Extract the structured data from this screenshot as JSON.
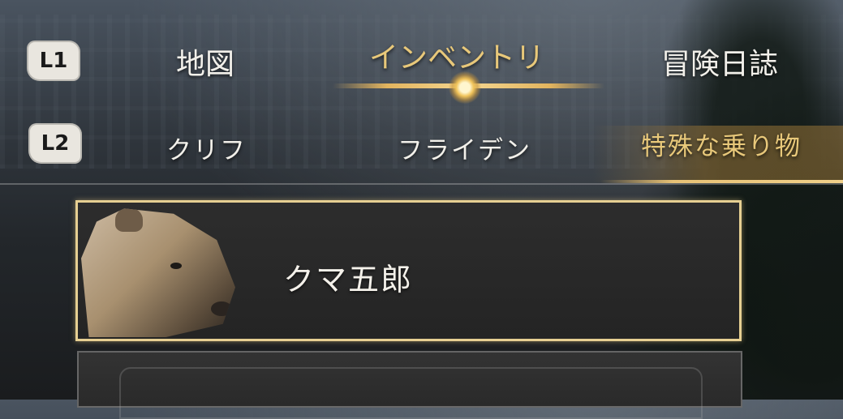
{
  "header": {
    "top_tabs": {
      "button_hint": "L1",
      "items": [
        {
          "label": "地図",
          "active": false
        },
        {
          "label": "インベントリ",
          "active": true
        },
        {
          "label": "冒険日誌",
          "active": false
        }
      ]
    },
    "sub_tabs": {
      "button_hint": "L2",
      "items": [
        {
          "label": "クリフ",
          "active": false
        },
        {
          "label": "フライデン",
          "active": false
        },
        {
          "label": "特殊な乗り物",
          "active": true
        }
      ]
    }
  },
  "inventory": {
    "items": [
      {
        "name": "クマ五郎",
        "icon": "bear-portrait-icon",
        "selected": true
      },
      {
        "name": "",
        "icon": "",
        "selected": false
      }
    ]
  },
  "colors": {
    "accent_gold": "#e8c87a",
    "selected_border": "#e6cf92",
    "text": "#f2f0ea"
  }
}
